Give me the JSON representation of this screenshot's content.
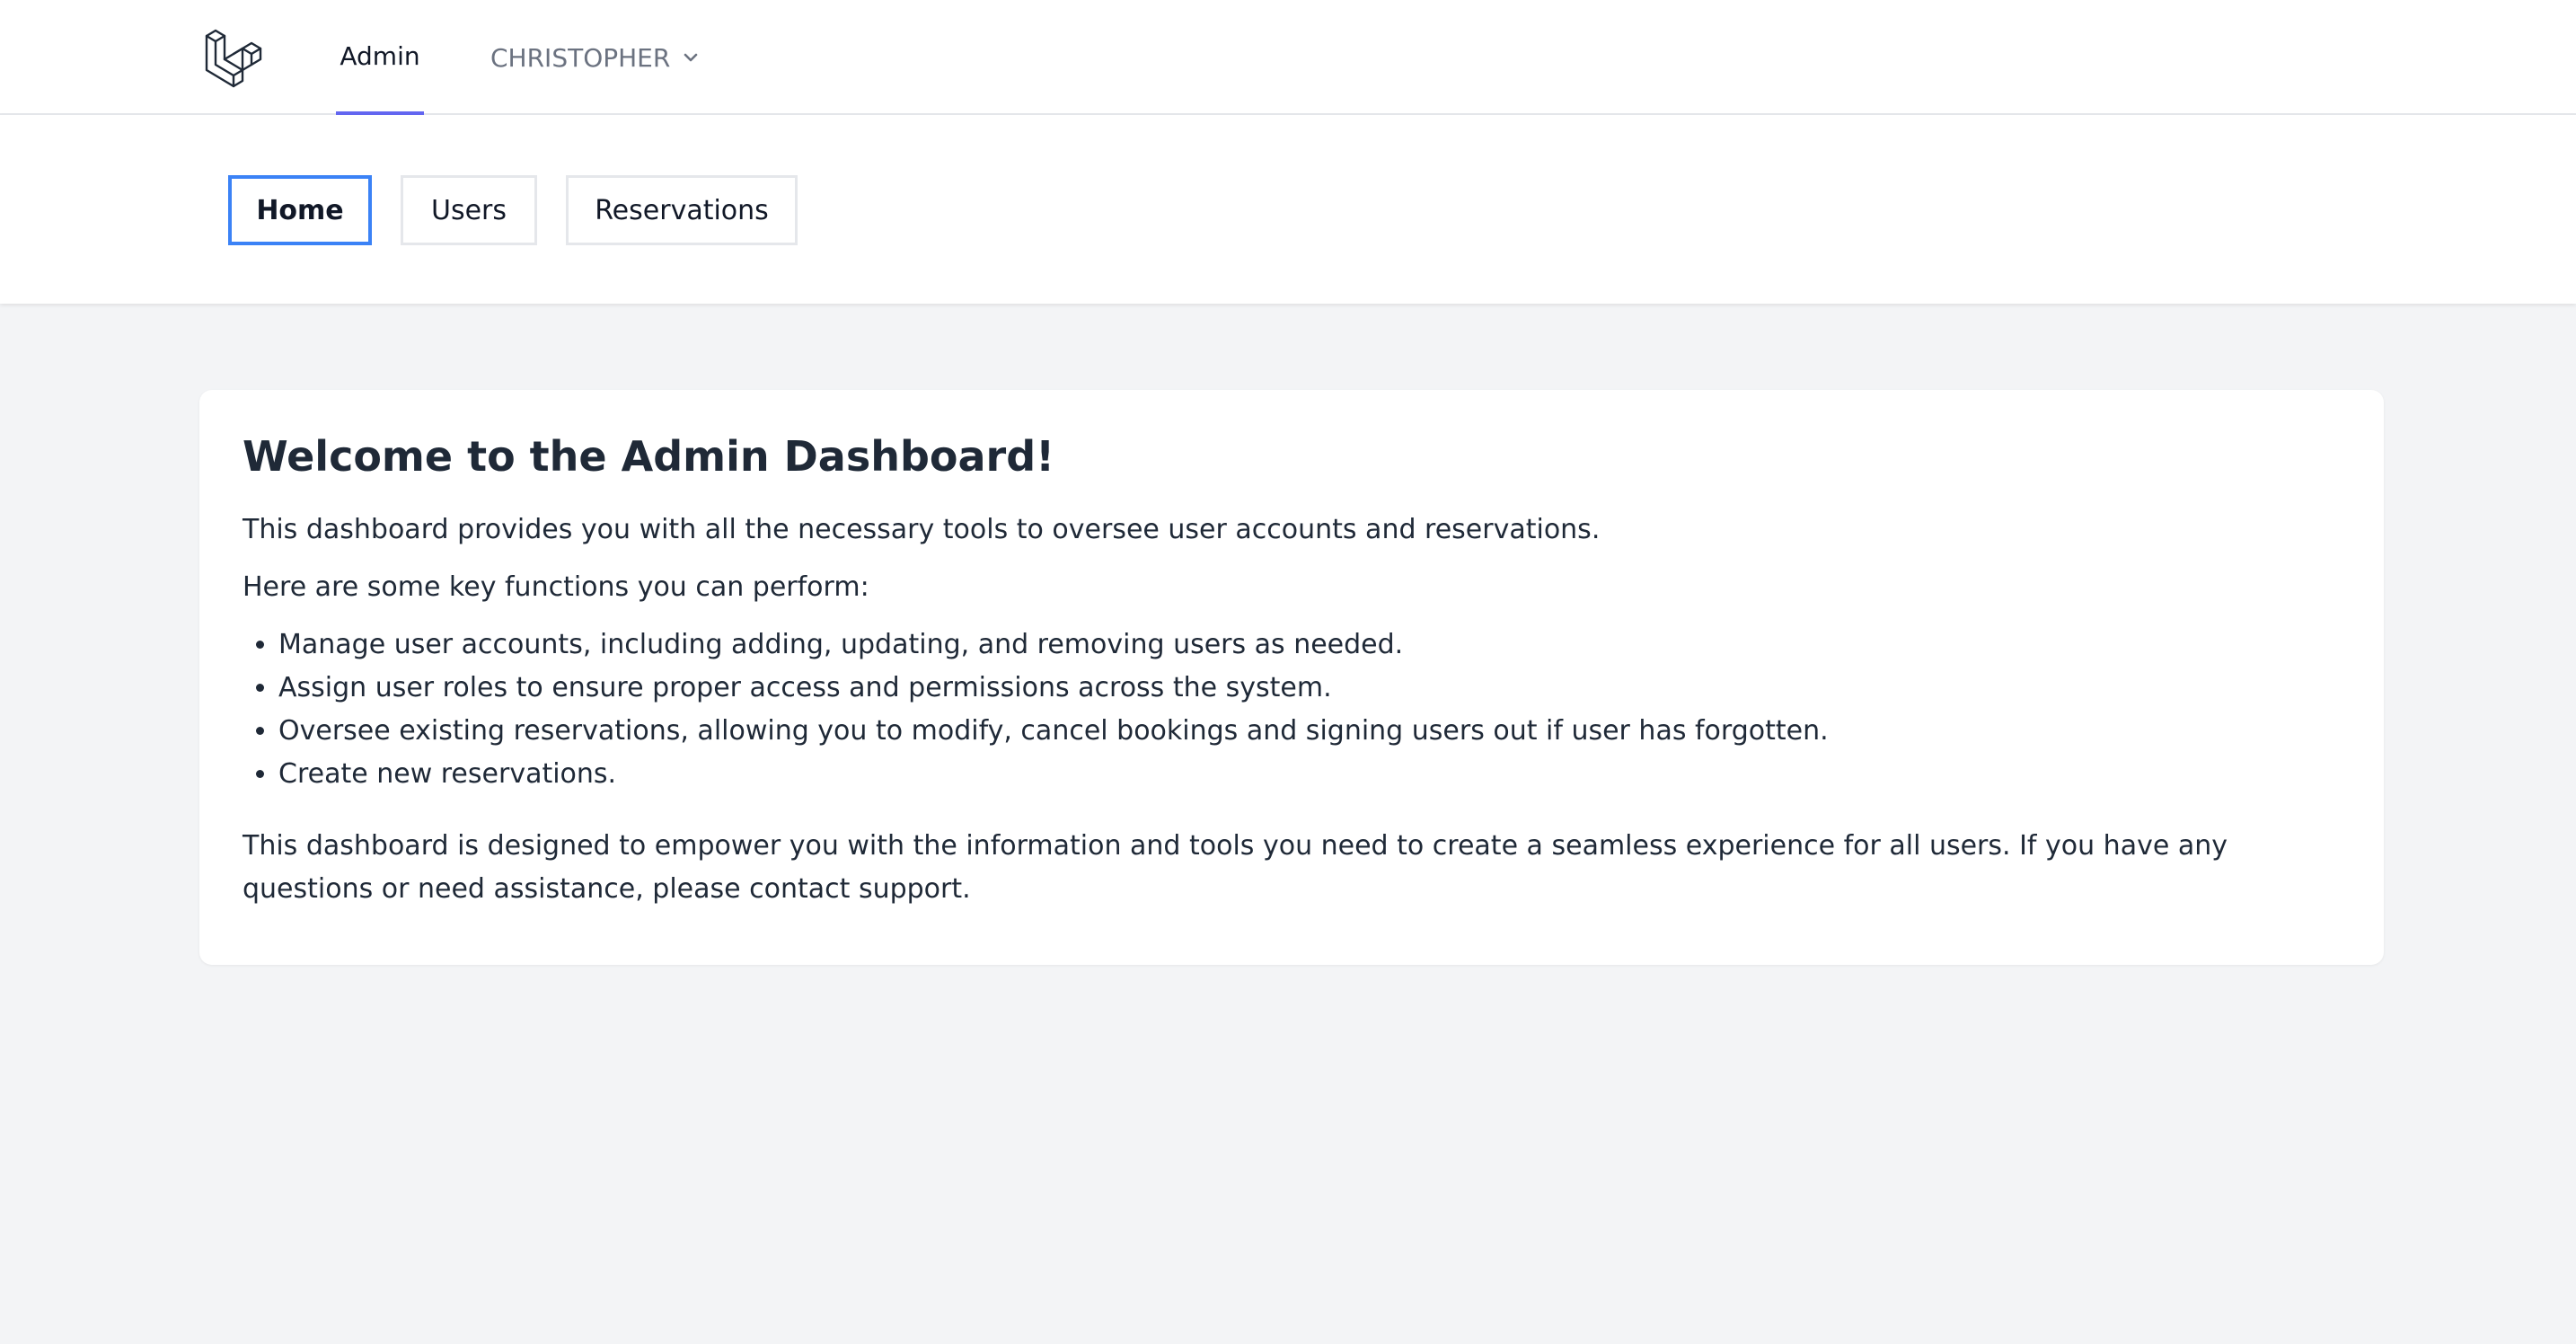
{
  "topnav": {
    "logo_icon": "laravel-logo-icon",
    "admin_label": "Admin",
    "user_label": "CHRISTOPHER",
    "user_dropdown_icon": "chevron-down-icon",
    "active_color": "#6366f1"
  },
  "subnav": {
    "tabs": [
      {
        "label": "Home",
        "active": true
      },
      {
        "label": "Users",
        "active": false
      },
      {
        "label": "Reservations",
        "active": false
      }
    ],
    "active_border_color": "#3b82f6"
  },
  "main": {
    "title": "Welcome to the Admin Dashboard!",
    "intro": "This dashboard provides you with all the necessary tools to oversee user accounts and reservations.",
    "lead": "Here are some key functions you can perform:",
    "functions": [
      "Manage user accounts, including adding, updating, and removing users as needed.",
      "Assign user roles to ensure proper access and permissions across the system.",
      "Oversee existing reservations, allowing you to modify, cancel bookings and signing users out if user has forgotten.",
      "Create new reservations."
    ],
    "closing": "This dashboard is designed to empower you with the information and tools you need to create a seamless experience for all users. If you have any questions or need assistance, please contact support."
  }
}
